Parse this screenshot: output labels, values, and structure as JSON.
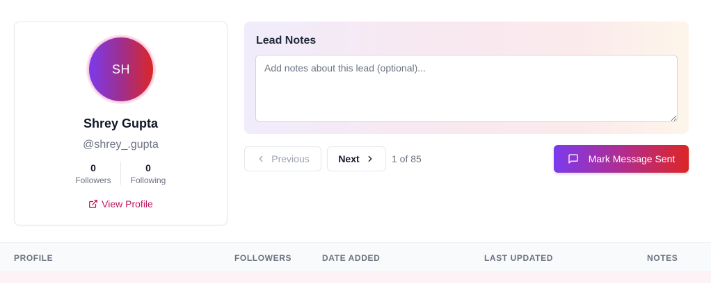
{
  "profile": {
    "initials": "SH",
    "name": "Shrey Gupta",
    "handle": "@shrey_.gupta",
    "followers_count": "0",
    "followers_label": "Followers",
    "following_count": "0",
    "following_label": "Following",
    "view_profile_label": "View Profile"
  },
  "notes": {
    "title": "Lead Notes",
    "placeholder": "Add notes about this lead (optional)...",
    "value": ""
  },
  "pagination": {
    "prev_label": "Previous",
    "next_label": "Next",
    "count_text": "1 of 85"
  },
  "actions": {
    "mark_sent_label": "Mark Message Sent"
  },
  "table": {
    "headers": [
      "PROFILE",
      "FOLLOWERS",
      "DATE ADDED",
      "LAST UPDATED",
      "NOTES"
    ]
  },
  "icons": {
    "external_link": "external-link-icon",
    "chevron_left": "chevron-left-icon",
    "chevron_right": "chevron-right-icon",
    "message": "message-square-icon"
  },
  "colors": {
    "accent_pink": "#be185d",
    "gradient_start": "#7c3aed",
    "gradient_end": "#dc2626"
  }
}
